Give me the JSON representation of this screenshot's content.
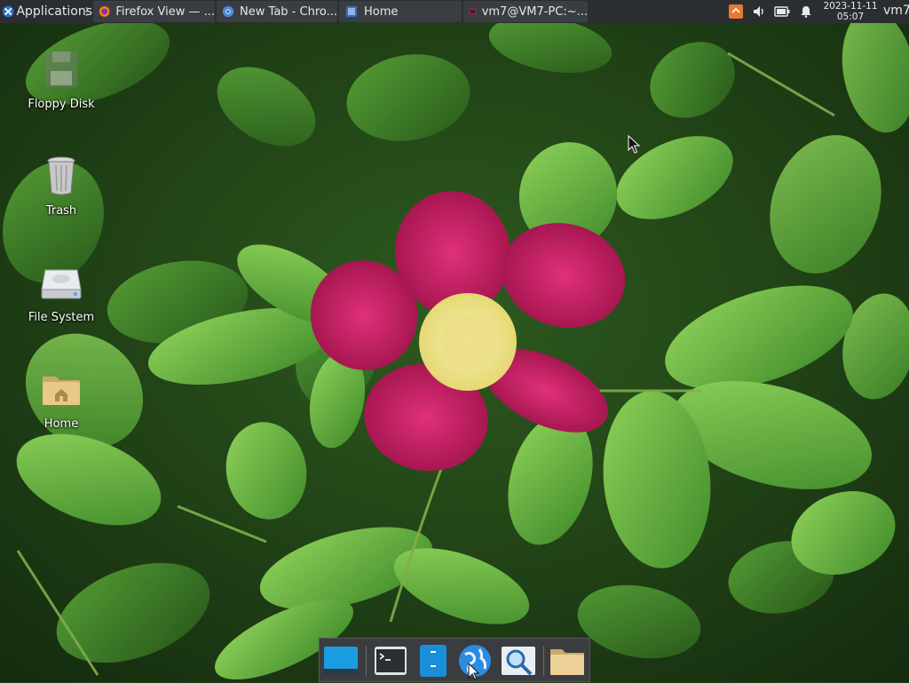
{
  "top_panel": {
    "applications_label": "Applications",
    "tasks": [
      {
        "label": "Firefox View — ...",
        "icon": "firefox-icon"
      },
      {
        "label": "New Tab - Chro...",
        "icon": "chromium-icon"
      },
      {
        "label": "Home",
        "icon": "file-manager-icon"
      },
      {
        "label": "vm7@VM7-PC:~...",
        "icon": "terminal-icon"
      }
    ],
    "tray_icons": [
      "update-icon",
      "volume-icon",
      "battery-icon",
      "notification-bell-icon"
    ],
    "clock": {
      "date": "2023-11-11",
      "time": "05:07"
    },
    "user": "vm7"
  },
  "desktop_icons": [
    {
      "label": "Floppy Disk",
      "icon": "floppy-disk-icon"
    },
    {
      "label": "Trash",
      "icon": "trash-icon"
    },
    {
      "label": "File System",
      "icon": "hard-drive-icon"
    },
    {
      "label": "Home",
      "icon": "home-folder-icon"
    }
  ],
  "dock": {
    "items": [
      "show-desktop-icon",
      "terminal-icon",
      "file-manager-icon",
      "web-browser-icon",
      "app-finder-icon",
      "folder-icon"
    ]
  },
  "colors": {
    "panel": "#2b2e31",
    "task_button": "#3a3d41",
    "dock": "#3a3c40",
    "flower": "#c01a5a",
    "leaf": "#5fae3c"
  }
}
